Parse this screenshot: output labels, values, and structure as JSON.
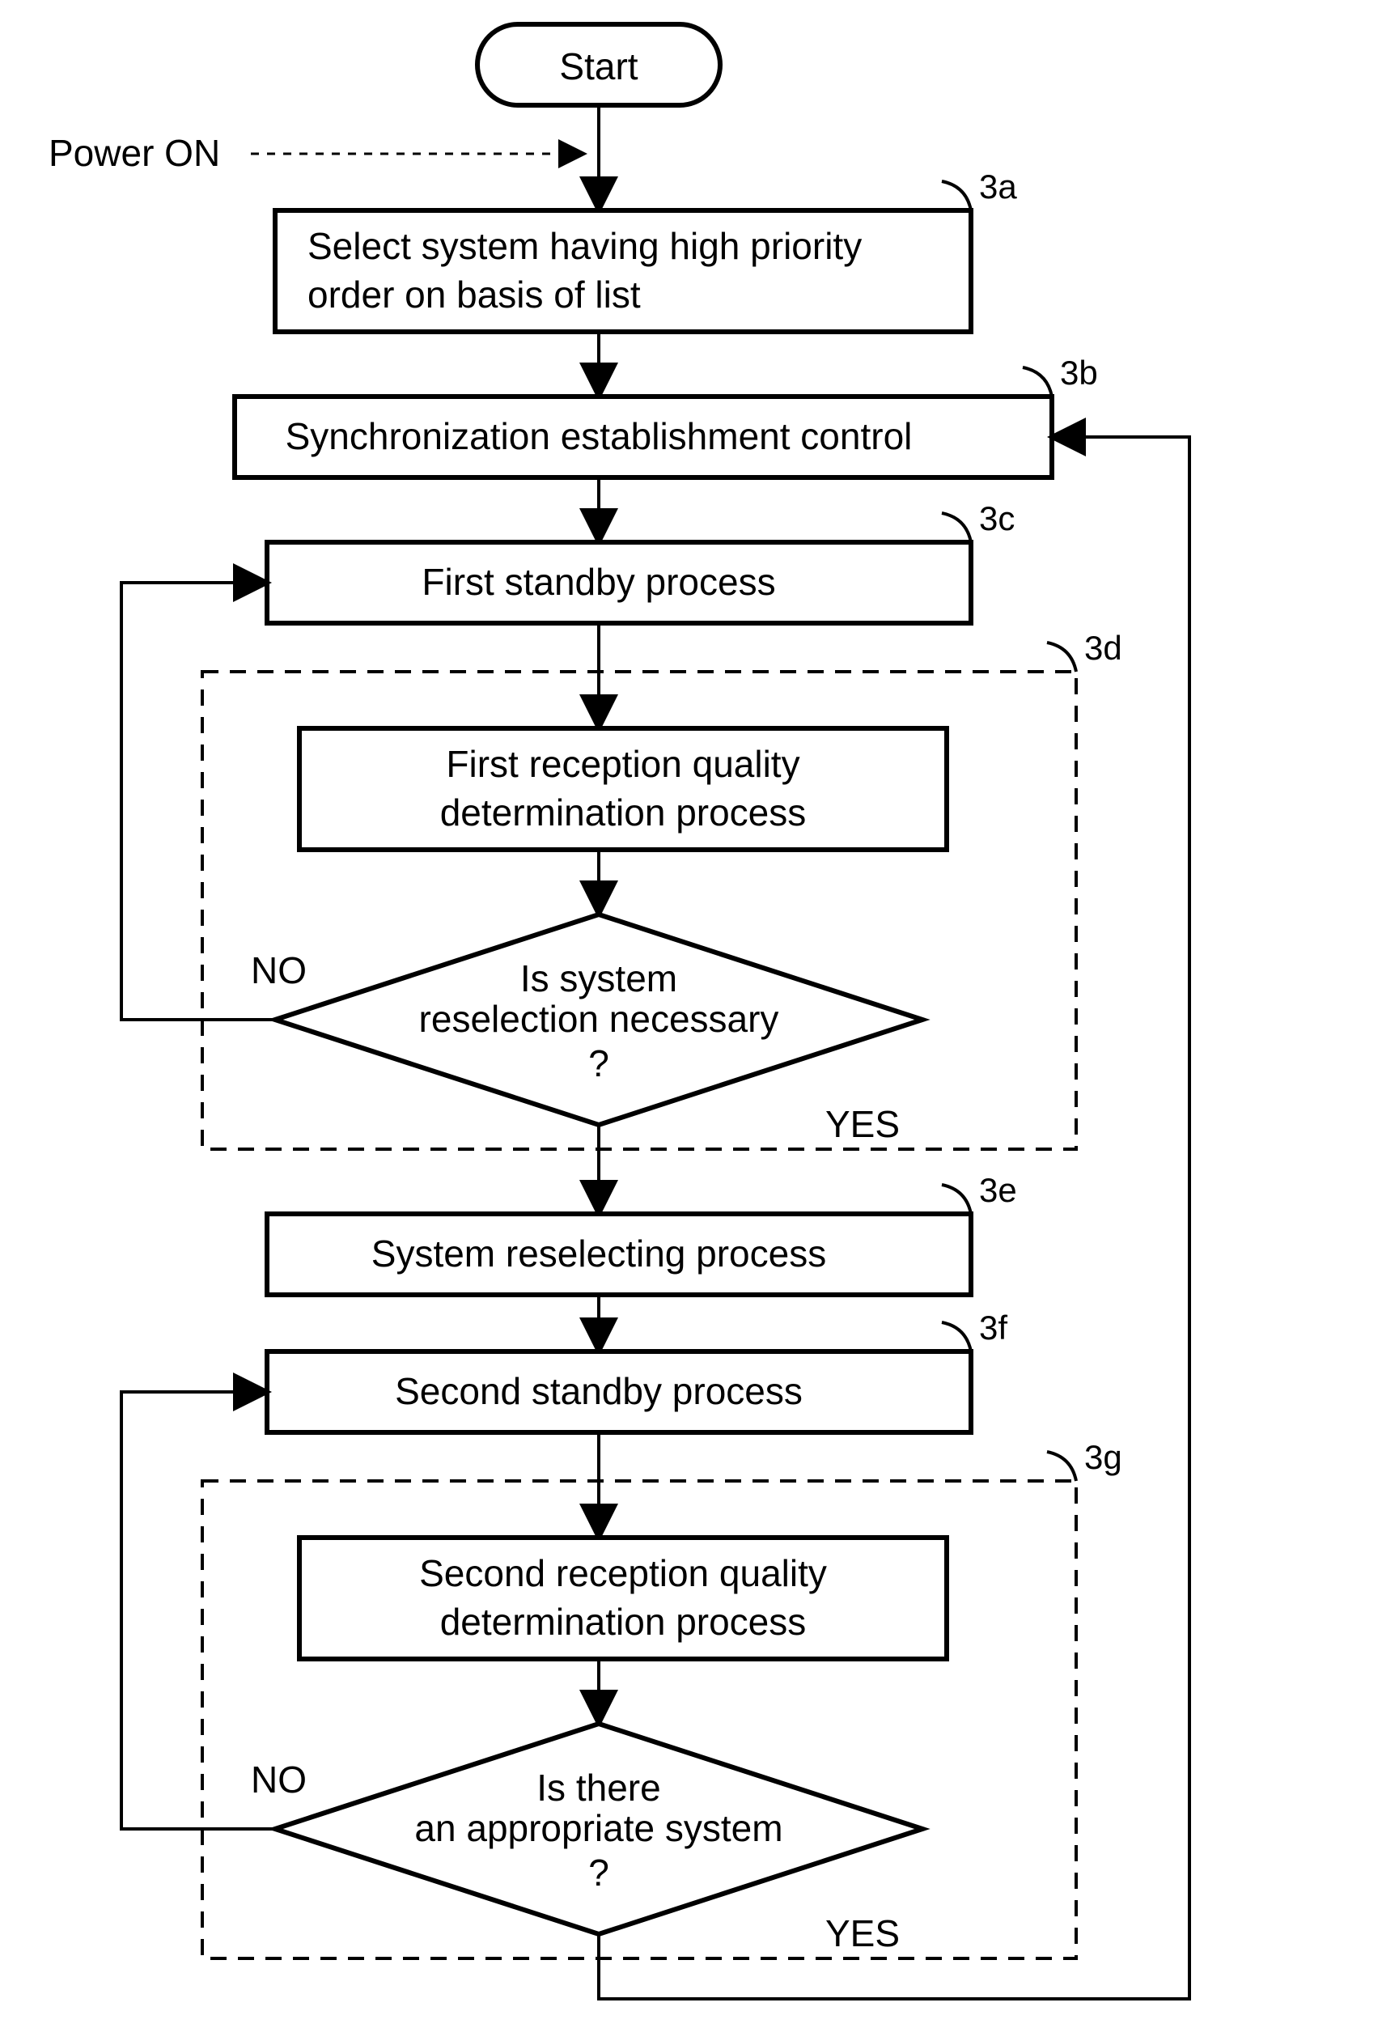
{
  "start": "Start",
  "power": "Power ON",
  "labels": {
    "a": "3a",
    "b": "3b",
    "c": "3c",
    "d": "3d",
    "e": "3e",
    "f": "3f",
    "g": "3g"
  },
  "boxes": {
    "a1": "Select system having high priority",
    "a2": "order on basis of list",
    "b": "Synchronization establishment control",
    "c": "First standby process",
    "d1": "First reception quality",
    "d2": "determination process",
    "e": "System reselecting process",
    "f": "Second standby process",
    "g1": "Second reception quality",
    "g2": "determination process"
  },
  "decisions": {
    "d1l1": "Is system",
    "d1l2": "reselection necessary",
    "d1l3": "?",
    "d2l1": "Is there",
    "d2l2": "an appropriate system",
    "d2l3": "?"
  },
  "branches": {
    "no": "NO",
    "yes": "YES"
  }
}
